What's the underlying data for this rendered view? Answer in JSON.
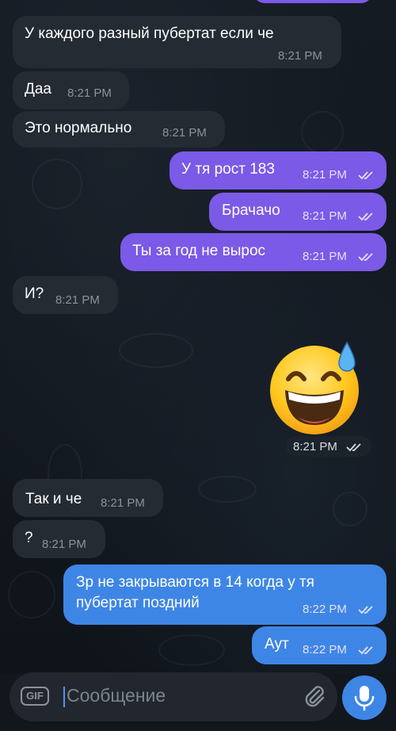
{
  "messages": [
    {
      "text": "У каждого разный пубертат если че",
      "time": "8:21 PM"
    },
    {
      "text": "Даа",
      "time": "8:21 PM"
    },
    {
      "text": "Это нормально",
      "time": "8:21 PM"
    },
    {
      "text": "У тя рост 183",
      "time": "8:21 PM"
    },
    {
      "text": "Брачачо",
      "time": "8:21 PM"
    },
    {
      "text": "Ты за год не вырос",
      "time": "8:21 PM"
    },
    {
      "text": "И?",
      "time": "8:21 PM"
    },
    {
      "time": "8:21 PM"
    },
    {
      "text": "Так и че",
      "time": "8:21 PM"
    },
    {
      "text": "?",
      "time": "8:21 PM"
    },
    {
      "text_line1": "Зр не закрываются в 14 когда у тя",
      "text_line2": "пубертат поздний",
      "time": "8:22 PM"
    },
    {
      "text": "Аут",
      "time": "8:22 PM"
    }
  ],
  "input": {
    "gif_label": "GIF",
    "placeholder": "Сообщение"
  },
  "icons": {
    "attach": "paperclip-icon",
    "mic": "microphone-icon",
    "sticker": "grinning-sweat-emoji"
  },
  "colors": {
    "incoming": "#252b33",
    "outgoing": "#7a5ae6",
    "outgoing_alt": "#3e86e6",
    "background": "#12171e"
  }
}
